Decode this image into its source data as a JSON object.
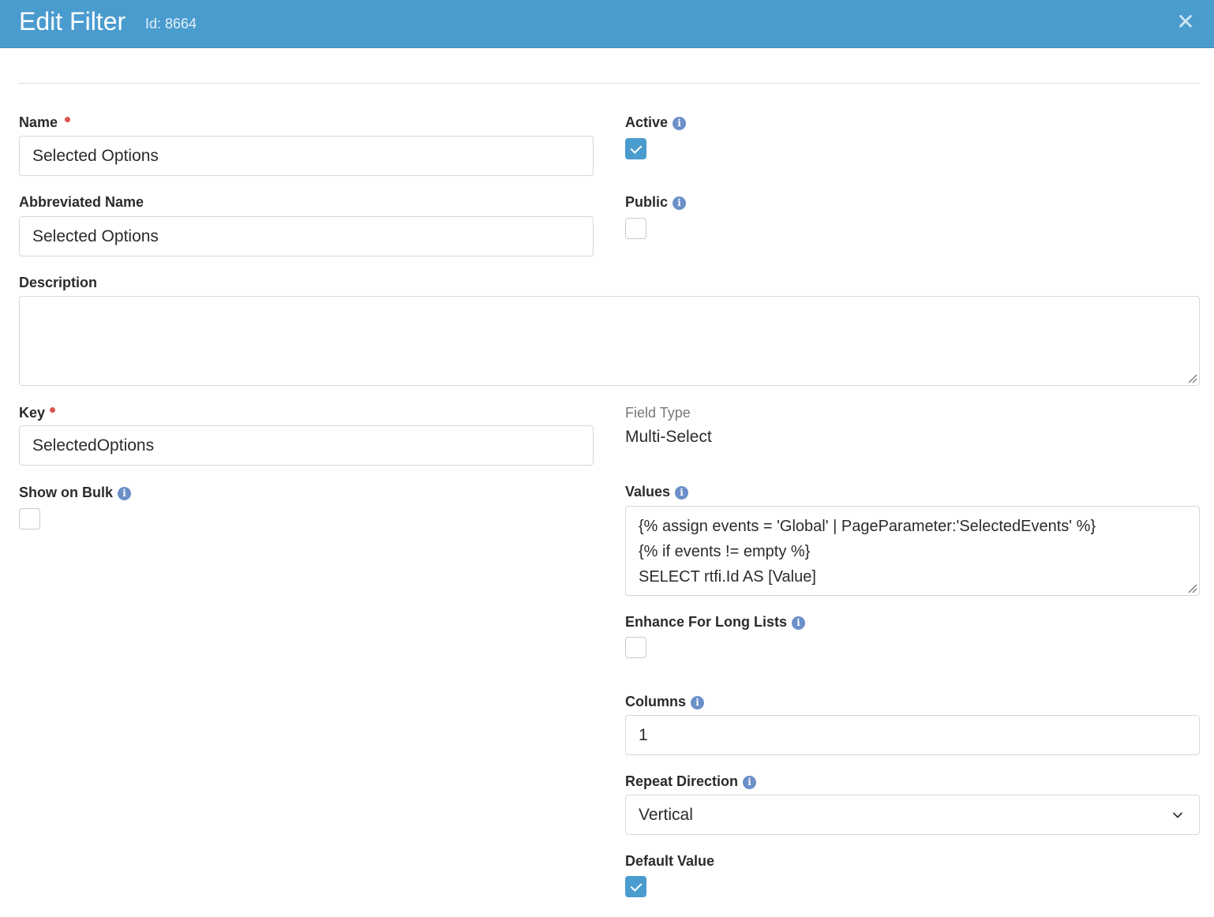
{
  "dialog": {
    "title": "Edit Filter",
    "id_text": "Id: 8664",
    "close_glyph": "✕"
  },
  "form": {
    "name": {
      "label": "Name",
      "value": "Selected Options",
      "required": true
    },
    "abbreviated_name": {
      "label": "Abbreviated Name",
      "value": "Selected Options"
    },
    "description": {
      "label": "Description",
      "value": ""
    },
    "key": {
      "label": "Key",
      "value": "SelectedOptions",
      "required": true
    },
    "show_on_bulk": {
      "label": "Show on Bulk",
      "checked": false
    },
    "active": {
      "label": "Active",
      "checked": true
    },
    "public": {
      "label": "Public",
      "checked": false
    },
    "field_type": {
      "label": "Field Type",
      "value": "Multi-Select"
    },
    "values": {
      "label": "Values",
      "lines": [
        "{% assign events = 'Global' | PageParameter:'SelectedEvents' %}",
        "{% if events != empty %}",
        "SELECT rtfi.Id AS [Value]"
      ]
    },
    "enhance_for_long_lists": {
      "label": "Enhance For Long Lists",
      "checked": false
    },
    "columns": {
      "label": "Columns",
      "value": "1"
    },
    "repeat_direction": {
      "label": "Repeat Direction",
      "value": "Vertical"
    },
    "default_value": {
      "label": "Default Value",
      "checked": true
    }
  },
  "icons": {
    "info": "info-icon",
    "check": "check-icon",
    "close": "close-icon",
    "chevron": "chevron-down-icon",
    "resize": "resize-handle-icon"
  },
  "colors": {
    "header_bg": "#4a9ccf",
    "checkbox_checked": "#4a9ccf",
    "required_dot": "#d9534f",
    "info_icon": "#6b8fc8"
  }
}
